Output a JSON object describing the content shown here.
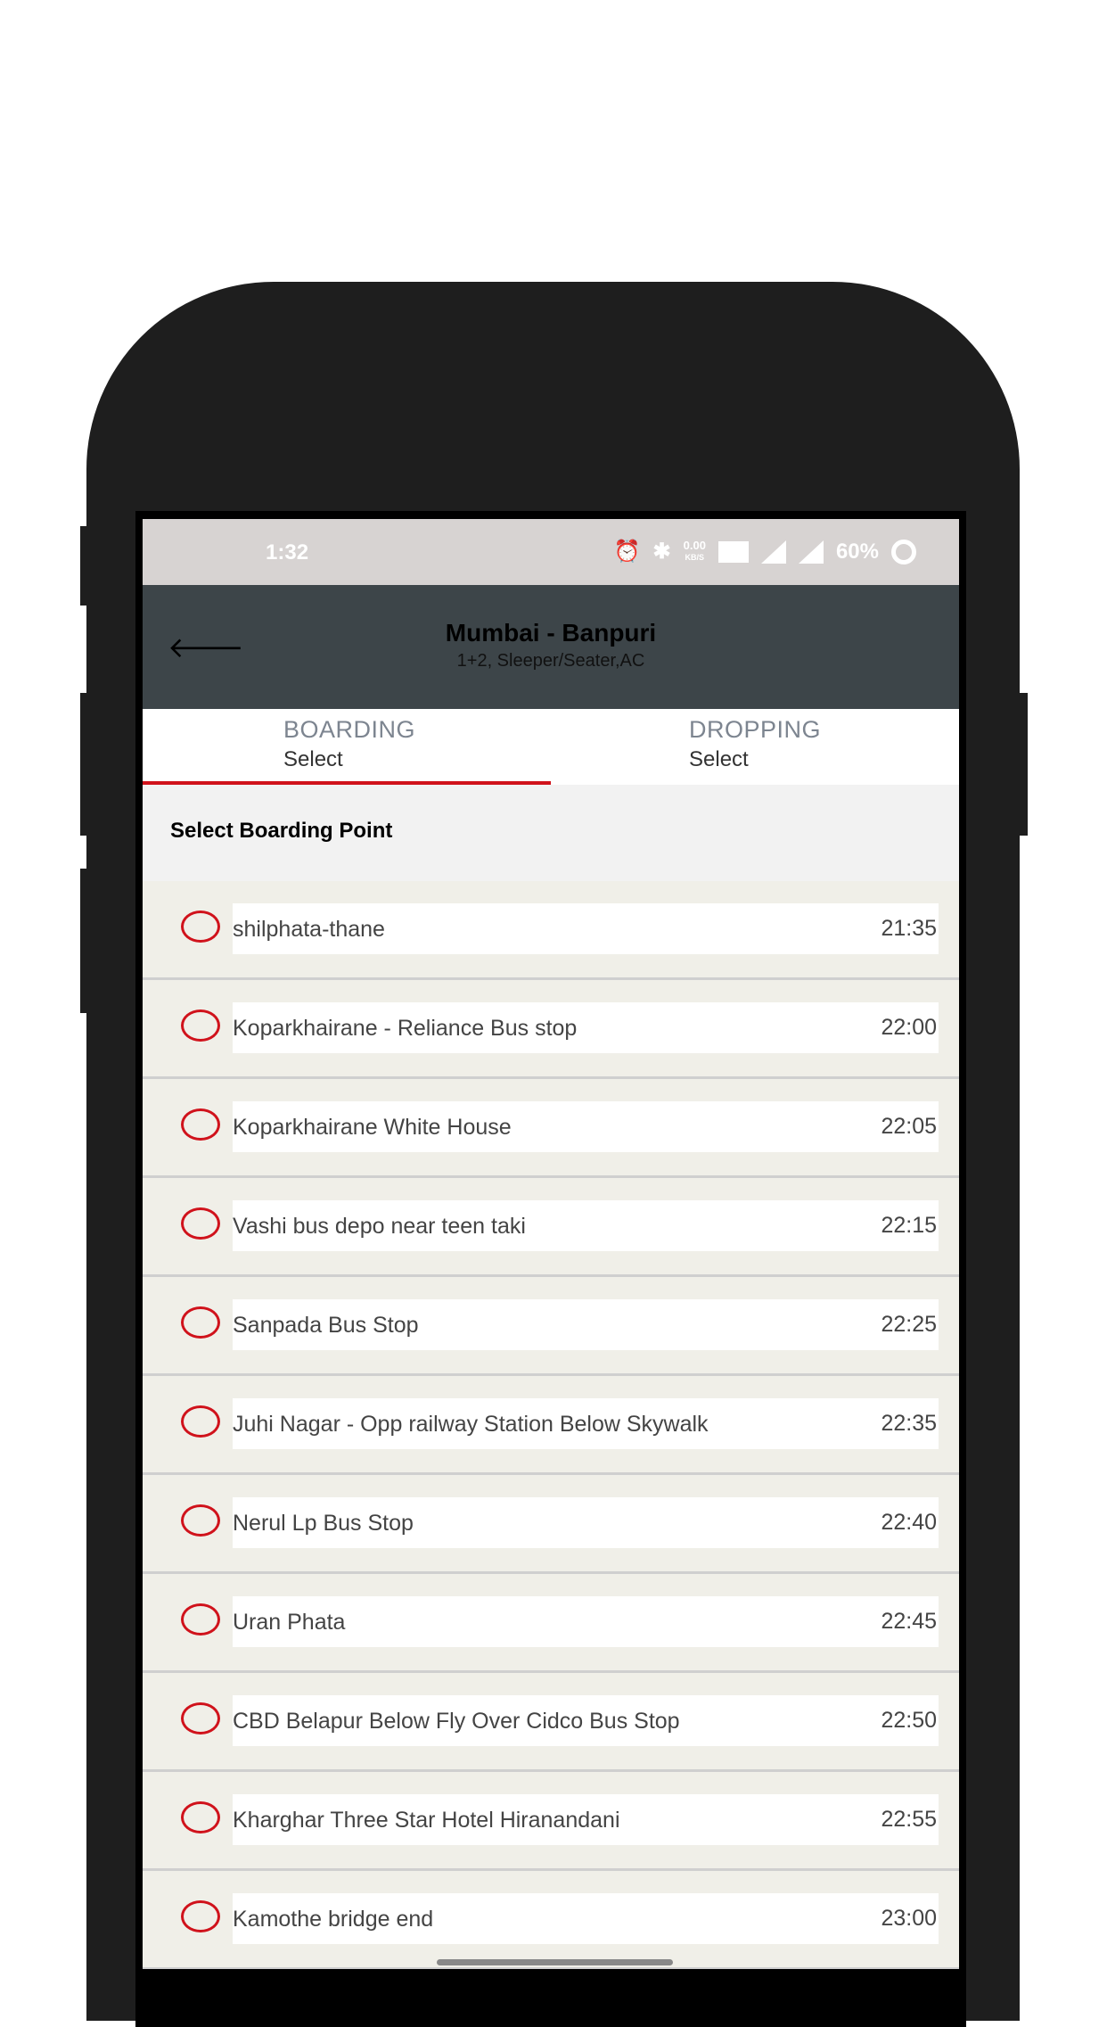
{
  "status_bar": {
    "time": "1:32",
    "net_speed": "0.00",
    "net_unit": "KB/S",
    "battery": "60%",
    "icons": [
      "alarm-icon",
      "bluetooth-icon",
      "volte-icon",
      "signal-4g-icon",
      "signal-icon",
      "battery-icon"
    ]
  },
  "header": {
    "title": "Mumbai - Banpuri",
    "subtitle": "1+2, Sleeper/Seater,AC"
  },
  "tabs": [
    {
      "label": "BOARDING",
      "value": "Select",
      "active": true
    },
    {
      "label": "DROPPING",
      "value": "Select",
      "active": false
    }
  ],
  "section_title": "Select Boarding Point",
  "points": [
    {
      "name": "shilphata-thane",
      "time": "21:35"
    },
    {
      "name": "Koparkhairane - Reliance Bus stop",
      "time": "22:00"
    },
    {
      "name": "Koparkhairane White House",
      "time": "22:05"
    },
    {
      "name": "Vashi bus depo near teen taki",
      "time": "22:15"
    },
    {
      "name": "Sanpada Bus Stop",
      "time": "22:25"
    },
    {
      "name": "Juhi Nagar - Opp railway Station Below Skywalk",
      "time": "22:35"
    },
    {
      "name": "Nerul Lp Bus Stop",
      "time": "22:40"
    },
    {
      "name": "Uran Phata",
      "time": "22:45"
    },
    {
      "name": "CBD Belapur Below Fly Over Cidco Bus Stop",
      "time": "22:50"
    },
    {
      "name": "Kharghar Three Star Hotel Hiranandani",
      "time": "22:55"
    },
    {
      "name": "Kamothe bridge end",
      "time": "23:00"
    }
  ],
  "colors": {
    "accent": "#d0121b",
    "header": "#3d4549",
    "status_bar": "#d7d3d2",
    "row_bg": "#f0efe8"
  }
}
